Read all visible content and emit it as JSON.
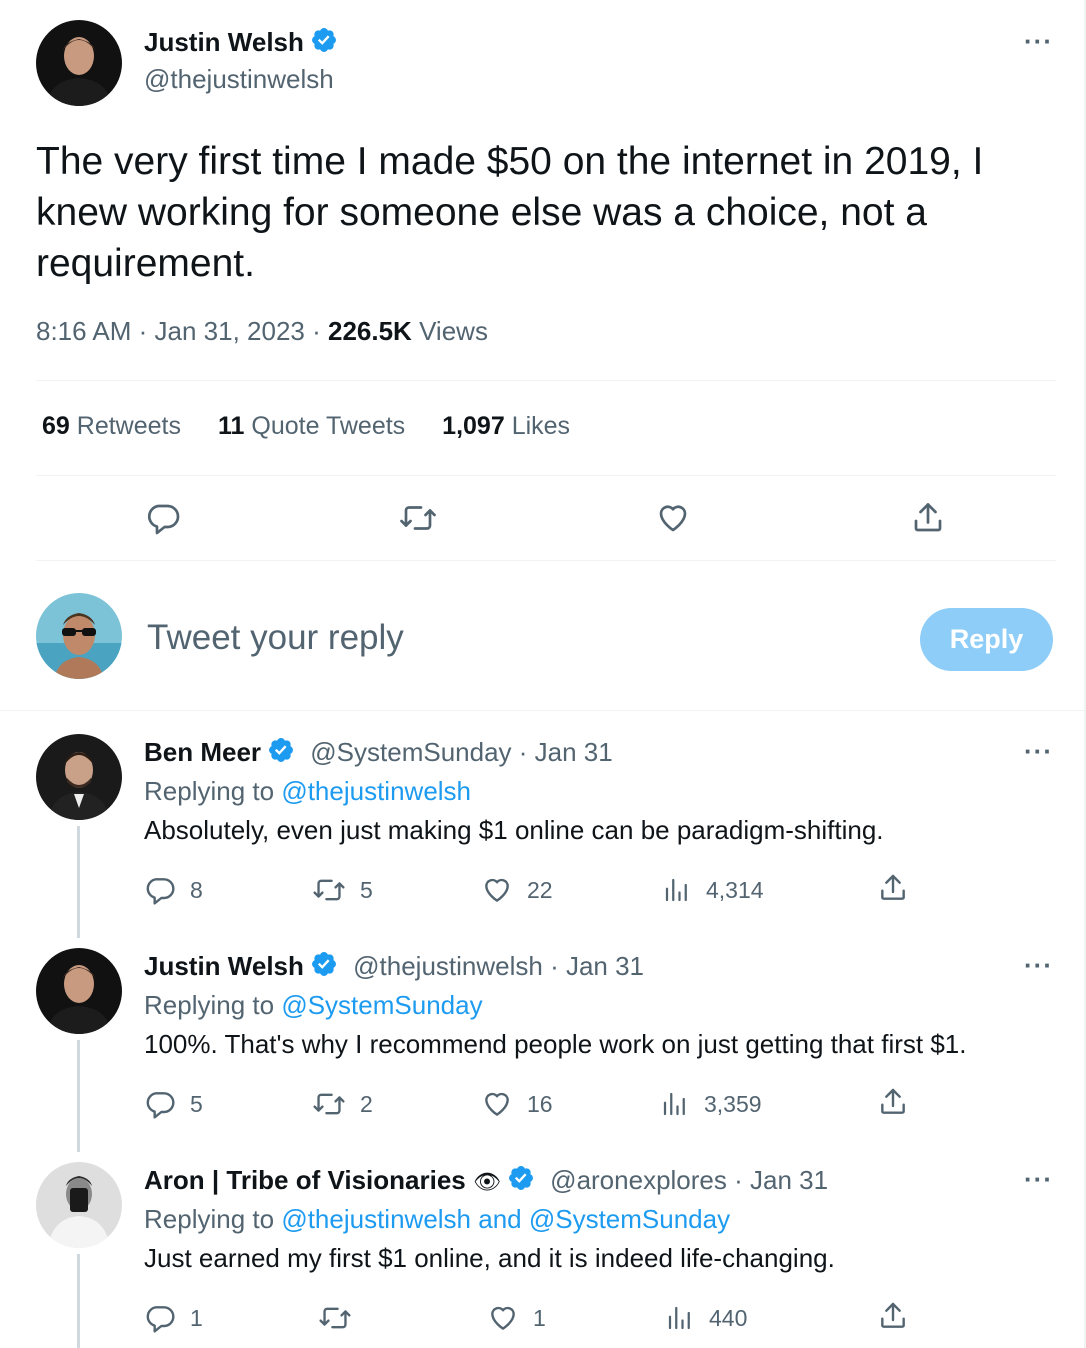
{
  "colors": {
    "accent": "#1d9bf0",
    "reply_button_bg": "#8ecdf8",
    "muted_text": "#536471",
    "divider": "#eff3f4"
  },
  "main_tweet": {
    "author_name": "Justin Welsh",
    "author_handle": "@thejustinwelsh",
    "verified_icon": "verified-badge-icon",
    "more_icon": "more-options-icon",
    "text": "The very first time I made $50 on the internet in 2019, I knew working for someone else was a choice, not a requirement.",
    "time": "8:16 AM",
    "date": "Jan 31, 2023",
    "views_count": "226.5K",
    "views_label": "Views",
    "separator": " · ",
    "stats": {
      "retweets_count": "69",
      "retweets_label": "Retweets",
      "quotes_count": "11",
      "quotes_label": "Quote Tweets",
      "likes_count": "1,097",
      "likes_label": "Likes"
    },
    "actions": [
      "reply-icon",
      "retweet-icon",
      "like-icon",
      "share-icon"
    ]
  },
  "compose": {
    "placeholder": "Tweet your reply",
    "button_label": "Reply"
  },
  "replies": [
    {
      "name": "Ben Meer",
      "handle": "@SystemSunday",
      "date": " · Jan 31",
      "replying_prefix": "Replying to ",
      "replying_to": "@thejustinwelsh",
      "text": "Absolutely, even just making $1 online can be paradigm-shifting.",
      "replies": "8",
      "retweets": "5",
      "likes": "22",
      "views": "4,314"
    },
    {
      "name": "Justin Welsh",
      "handle": "@thejustinwelsh",
      "date": " · Jan 31",
      "replying_prefix": "Replying to ",
      "replying_to": "@SystemSunday",
      "text": "100%. That's why I recommend people work on just getting that first $1.",
      "replies": "5",
      "retweets": "2",
      "likes": "16",
      "views": "3,359"
    },
    {
      "name": "Aron | Tribe of Visionaries",
      "name_emoji": "👁",
      "handle": "@aronexplores",
      "date": " · Jan 31",
      "replying_prefix": "Replying to ",
      "replying_to": "@thejustinwelsh and @SystemSunday",
      "text": "Just earned my first $1 online, and it is indeed life-changing.",
      "replies": "1",
      "retweets": "",
      "likes": "1",
      "views": "440"
    }
  ]
}
